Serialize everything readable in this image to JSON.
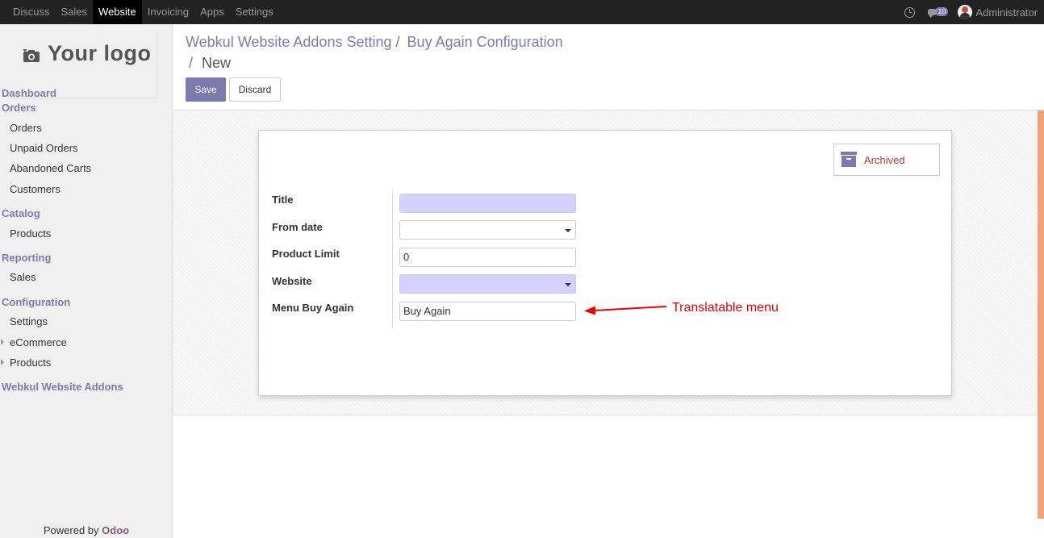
{
  "topbar": {
    "menu": [
      "Discuss",
      "Sales",
      "Website",
      "Invoicing",
      "Apps",
      "Settings"
    ],
    "active_menu": "Website",
    "notification_count": "10",
    "user": "Administrator"
  },
  "sidebar": {
    "logo_text": "Your logo",
    "dashboard": "Dashboard",
    "orders_head": "Orders",
    "orders_items": [
      "Orders",
      "Unpaid Orders",
      "Abandoned Carts",
      "Customers"
    ],
    "catalog_head": "Catalog",
    "catalog_items": [
      "Products"
    ],
    "reporting_head": "Reporting",
    "reporting_items": [
      "Sales"
    ],
    "configuration_head": "Configuration",
    "configuration_items": [
      "Settings",
      "eCommerce",
      "Products"
    ],
    "webkul_head": "Webkul Website Addons",
    "powered_by": "Powered by",
    "powered_brand": "Odoo"
  },
  "breadcrumb": {
    "crumb1": "Webkul Website Addons Setting",
    "crumb2": "Buy Again Configuration",
    "separator": "/",
    "current": "New"
  },
  "buttons": {
    "save": "Save",
    "discard": "Discard",
    "archived": "Archived"
  },
  "form": {
    "title_label": "Title",
    "title_value": "",
    "from_date_label": "From date",
    "from_date_value": "",
    "product_limit_label": "Product Limit",
    "product_limit_value": "0",
    "website_label": "Website",
    "website_value": "",
    "menu_label": "Menu Buy Again",
    "menu_value": "Buy Again"
  },
  "annotation": {
    "text": "Translatable menu",
    "color": "#e00000"
  },
  "colors": {
    "primary": "#7c7bad",
    "required_field": "#d2d2ff",
    "archived_text": "#b03a2e"
  }
}
